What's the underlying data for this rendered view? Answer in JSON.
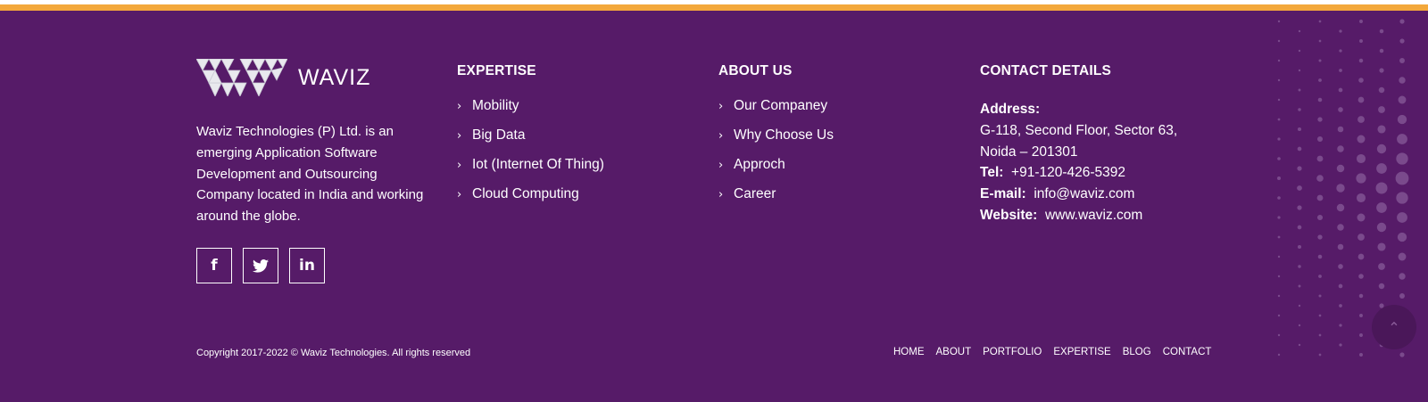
{
  "colors": {
    "accent_bar": "#f3a83b",
    "footer_bg": "#561b68",
    "text": "#ffffff"
  },
  "brand": {
    "logo_icon": "waviz-triangle-logo-icon",
    "name": "WAVIZ",
    "description": "Waviz Technologies (P) Ltd. is an emerging Application Software Development and Outsourcing Company located in India and working around the globe.",
    "socials": [
      {
        "icon": "facebook-icon",
        "glyph": "f"
      },
      {
        "icon": "twitter-icon",
        "glyph": "🐦"
      },
      {
        "icon": "linkedin-icon",
        "glyph": "in"
      }
    ]
  },
  "expertise": {
    "title": "EXPERTISE",
    "items": [
      "Mobility",
      "Big Data",
      "Iot (Internet Of Thing)",
      "Cloud Computing"
    ]
  },
  "about_us": {
    "title": "ABOUT US",
    "items": [
      "Our Companey",
      "Why Choose Us",
      "Approch",
      "Career"
    ]
  },
  "contact": {
    "title": "CONTACT DETAILS",
    "address_label": "Address:",
    "address_line1": "G-118, Second Floor, Sector 63,",
    "address_line2": "Noida – 201301",
    "tel_label": "Tel:",
    "tel_value": "+91-120-426-5392",
    "email_label": "E-mail:",
    "email_value": "info@waviz.com",
    "website_label": "Website:",
    "website_value": "www.waviz.com"
  },
  "footer": {
    "copyright": "Copyright 2017-2022 © Waviz Technologies. All rights reserved",
    "nav": [
      "HOME",
      "ABOUT",
      "PORTFOLIO",
      "EXPERTISE",
      "BLOG",
      "CONTACT"
    ]
  },
  "scroll_top": {
    "icon": "chevron-up-icon",
    "glyph": "⌃"
  }
}
